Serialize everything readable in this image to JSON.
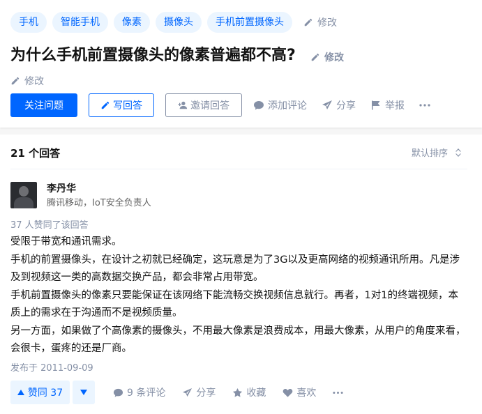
{
  "question": {
    "topics": [
      "手机",
      "智能手机",
      "像素",
      "摄像头",
      "手机前置摄像头"
    ],
    "topics_edit_label": "修改",
    "title": "为什么手机前置摄像头的像素普遍都不高?",
    "title_edit_label": "修改",
    "detail_edit_label": "修改",
    "actions": {
      "follow_label": "关注问题",
      "write_answer_label": "写回答",
      "invite_label": "邀请回答",
      "comment_label": "添加评论",
      "share_label": "分享",
      "report_label": "举报"
    }
  },
  "answers": {
    "count_label": "21 个回答",
    "sort_label": "默认排序",
    "answer": {
      "author_name": "李丹华",
      "author_bio": "腾讯移动，IoT安全负责人",
      "voters_text": "37 人赞同了该回答",
      "paragraphs": [
        "受限于带宽和通讯需求。",
        "手机的前置摄像头，在设计之初就已经确定，这玩意是为了3G以及更高网络的视频通讯所用。凡是涉及到视频这一类的高数据交换产品，都会非常占用带宽。",
        "手机前置摄像头的像素只要能保证在该网络下能流畅交换视频信息就行。再者，1对1的终端视频，本质上的需求在于沟通而不是视频质量。",
        "另一方面，如果做了个高像素的摄像头，不用最大像素是浪费成本，用最大像素，从用户的角度来看，会很卡，蛋疼的还是厂商。"
      ],
      "published": "发布于 2011-09-09",
      "vote_up_label": "赞同 37",
      "comments_label": "9 条评论",
      "share_label": "分享",
      "collect_label": "收藏",
      "like_label": "喜欢"
    }
  },
  "colors": {
    "brand": "#0066ff",
    "brand_light": "#ebf5ff",
    "muted": "#8590a6"
  }
}
